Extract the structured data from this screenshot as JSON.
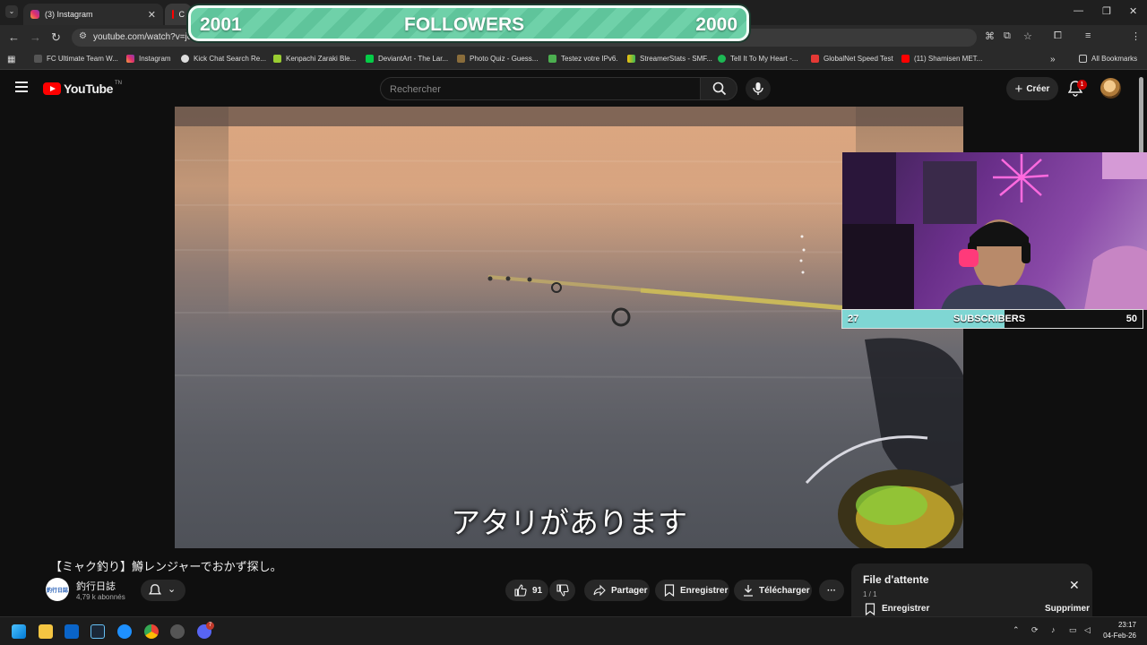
{
  "browser": {
    "tabs": [
      {
        "title": "(3) Instagram",
        "active": false
      },
      {
        "title": "C",
        "active": true
      }
    ],
    "url": "youtube.com/watch?v=jeZI",
    "bookmarks": [
      "FC Ultimate Team W...",
      "Instagram",
      "Kick Chat Search Re...",
      "Kenpachi Zaraki Ble...",
      "DeviantArt - The Lar...",
      "Photo Quiz - Guess...",
      "Testez votre IPv6.",
      "StreamerStats - SMF...",
      "Tell It To My Heart -...",
      "GlobalNet Speed Test",
      "(11) Shamisen MET..."
    ],
    "all_bookmarks": "All Bookmarks"
  },
  "overlay_followers": {
    "left": "2001",
    "label": "FOLLOWERS",
    "right": "2000"
  },
  "overlay_subscribers": {
    "left": "27",
    "label": "SUBSCRIBERS",
    "right": "50",
    "progress": 0.54
  },
  "youtube": {
    "logo": "YouTube",
    "logo_suffix": "TN",
    "search_placeholder": "Rechercher",
    "create_label": "Créer",
    "notifications_count": "1"
  },
  "video": {
    "subtitle": "アタリがあります",
    "title": "【ミャク釣り】鱒レンジャーでおかず探し。",
    "channel_avatar_text": "釣行日誌",
    "channel": "釣行日誌",
    "subscribers": "4,79 k abonnés",
    "likes": "91",
    "share_label": "Partager",
    "save_label": "Enregistrer",
    "download_label": "Télécharger",
    "more_label": "···"
  },
  "queue": {
    "title": "File d'attente",
    "count": "1 / 1",
    "save_label": "Enregistrer",
    "delete_label": "Supprimer"
  },
  "taskbar": {
    "time": "23:17",
    "date": "04-Feb-26",
    "chrome_badge": "7"
  },
  "colors": {
    "youtube_red": "#ff0000",
    "followers_green": "#6fd1a9",
    "subscribers_cyan": "#7fd6d3"
  }
}
